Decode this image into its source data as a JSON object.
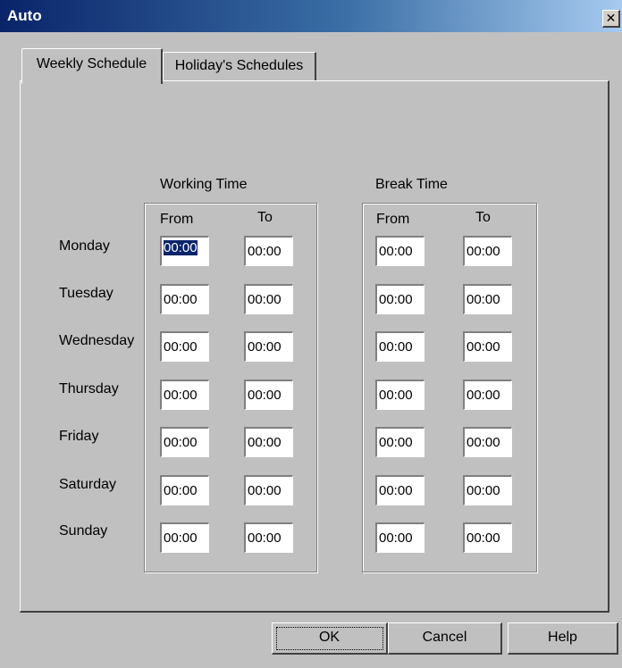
{
  "window": {
    "title": "Auto",
    "close_symbol": "✕"
  },
  "tabs": [
    {
      "label": "Weekly Schedule",
      "active": true
    },
    {
      "label": "Holiday's Schedules",
      "active": false
    }
  ],
  "working_time": {
    "title": "Working Time",
    "from_label": "From",
    "to_label": "To"
  },
  "break_time": {
    "title": "Break Time",
    "from_label": "From",
    "to_label": "To"
  },
  "days": [
    {
      "name": "Monday",
      "work_from": "00:00",
      "work_to": "00:00",
      "break_from": "00:00",
      "break_to": "00:00"
    },
    {
      "name": "Tuesday",
      "work_from": "00:00",
      "work_to": "00:00",
      "break_from": "00:00",
      "break_to": "00:00"
    },
    {
      "name": "Wednesday",
      "work_from": "00:00",
      "work_to": "00:00",
      "break_from": "00:00",
      "break_to": "00:00"
    },
    {
      "name": "Thursday",
      "work_from": "00:00",
      "work_to": "00:00",
      "break_from": "00:00",
      "break_to": "00:00"
    },
    {
      "name": "Friday",
      "work_from": "00:00",
      "work_to": "00:00",
      "break_from": "00:00",
      "break_to": "00:00"
    },
    {
      "name": "Saturday",
      "work_from": "00:00",
      "work_to": "00:00",
      "break_from": "00:00",
      "break_to": "00:00"
    },
    {
      "name": "Sunday",
      "work_from": "00:00",
      "work_to": "00:00",
      "break_from": "00:00",
      "break_to": "00:00"
    }
  ],
  "buttons": {
    "ok": "OK",
    "cancel": "Cancel",
    "help": "Help"
  },
  "colors": {
    "titlebar_start": "#0a246a",
    "titlebar_end": "#a6caf0",
    "face": "#c0c0c0",
    "selection": "#0a246a"
  }
}
